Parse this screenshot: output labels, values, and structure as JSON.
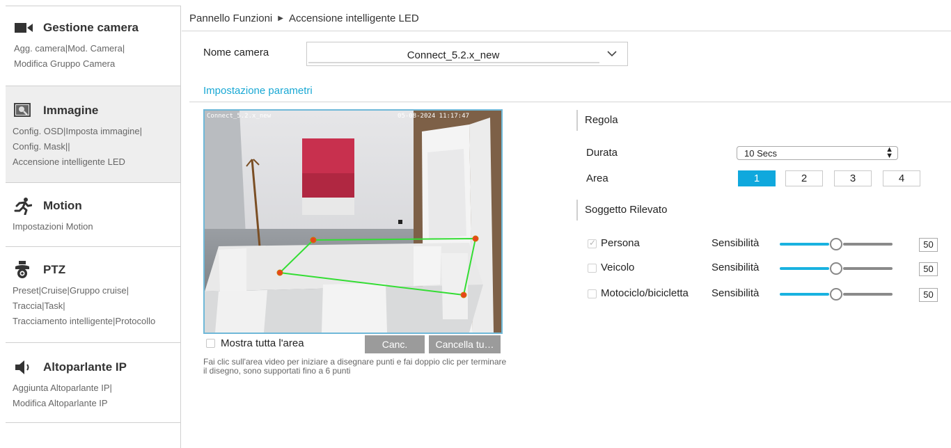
{
  "sidebar": {
    "sections": [
      {
        "title": "Gestione camera",
        "icon": "camera-icon",
        "links": [
          "Agg. camera",
          "Mod. Camera",
          "Modifica Gruppo Camera"
        ]
      },
      {
        "title": "Immagine",
        "icon": "image-settings-icon",
        "links": [
          "Config. OSD",
          "Imposta immagine",
          "Config. Mask",
          "Accensione intelligente LED"
        ]
      },
      {
        "title": "Motion",
        "icon": "running-person-icon",
        "links": [
          "Impostazioni Motion"
        ]
      },
      {
        "title": "PTZ",
        "icon": "ptz-camera-icon",
        "links": [
          "Preset",
          "Cruise",
          "Gruppo cruise",
          "Traccia",
          "Task",
          "Tracciamento intelligente",
          "Protocollo"
        ]
      },
      {
        "title": "Altoparlante IP",
        "icon": "speaker-icon",
        "links": [
          "Aggiunta Altoparlante IP",
          "Modifica Altoparlante IP"
        ]
      }
    ]
  },
  "breadcrumb": {
    "root": "Pannello Funzioni",
    "current": "Accensione intelligente LED"
  },
  "camera": {
    "label": "Nome camera",
    "selected": "Connect_5.2.x_new"
  },
  "section_title": "Impostazione parametri",
  "video": {
    "osd_name": "Connect_5.2.x_new",
    "osd_time": "05-08-2024 11:17:47",
    "show_all_label": "Mostra tutta l'area",
    "cancel_label": "Canc.",
    "clear_all_label": "Cancella tu…",
    "hint": "Fai clic sull'area video per iniziare a disegnare punti e fai doppio clic per terminare il disegno, sono supportati fino a 6 punti"
  },
  "rule": {
    "title": "Regola",
    "duration_label": "Durata",
    "duration_value": "10 Secs",
    "area_label": "Area",
    "areas": [
      "1",
      "2",
      "3",
      "4"
    ],
    "selected_area": "1"
  },
  "detection": {
    "title": "Soggetto Rilevato",
    "sensitivity_label": "Sensibilità",
    "objects": [
      {
        "name": "Persona",
        "checked": true,
        "sensitivity": 50
      },
      {
        "name": "Veicolo",
        "checked": false,
        "sensitivity": 50
      },
      {
        "name": "Motociclo/bicicletta",
        "checked": false,
        "sensitivity": 50
      }
    ]
  },
  "colors": {
    "accent": "#10a8dd",
    "polygon": "#33dd33",
    "vertex": "#e8441c"
  }
}
